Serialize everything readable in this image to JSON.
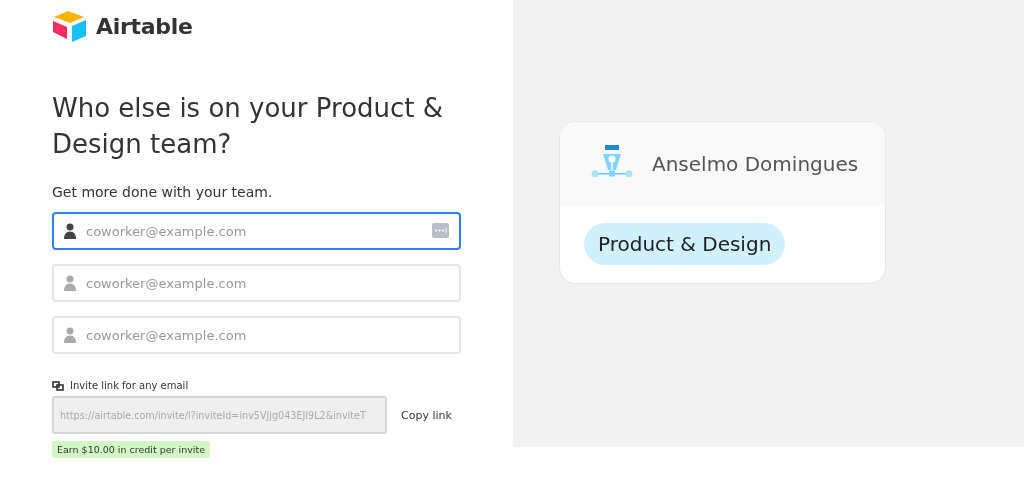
{
  "logo": {
    "text": "Airtable"
  },
  "heading": "Who else is on your Product & Design team?",
  "subheading": "Get more done with your team.",
  "email_fields": [
    {
      "placeholder": "coworker@example.com",
      "focused": true
    },
    {
      "placeholder": "coworker@example.com",
      "focused": false
    },
    {
      "placeholder": "coworker@example.com",
      "focused": false
    }
  ],
  "invite_link": {
    "label": "Invite link for any email",
    "value": "https://airtable.com/invite/l?inviteId=inv5VJjg043EJI9L2&inviteT",
    "button": "Copy link",
    "badge": "Earn $10.00 in credit per invite"
  },
  "card": {
    "name": "Anselmo Domingues",
    "team": "Product & Design"
  }
}
